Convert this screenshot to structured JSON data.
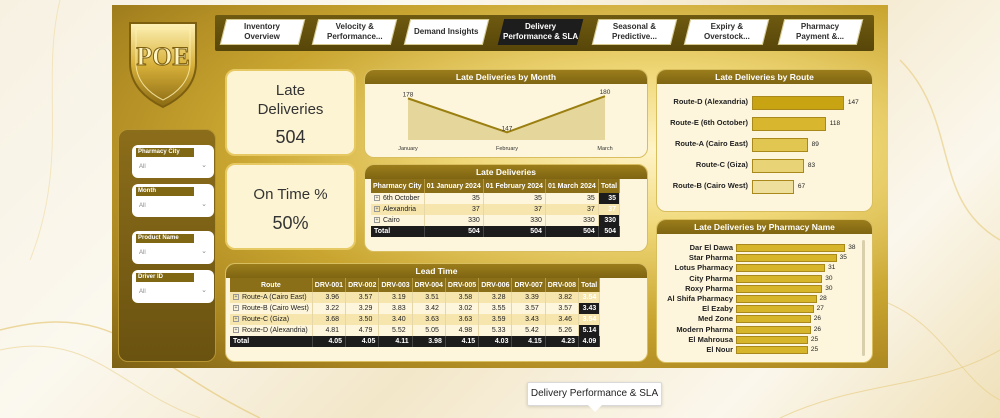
{
  "nav": {
    "items": [
      {
        "label": "Inventory Overview",
        "lines": [
          "Inventory",
          "Overview"
        ],
        "active": false
      },
      {
        "label": "Velocity & Performance...",
        "lines": [
          "Velocity &",
          "Performance..."
        ],
        "active": false
      },
      {
        "label": "Demand Insights",
        "lines": [
          "Demand Insights"
        ],
        "active": false
      },
      {
        "label": "Delivery Performance & SLA",
        "lines": [
          "Delivery",
          "Performance & SLA"
        ],
        "active": true
      },
      {
        "label": "Seasonal & Predictive...",
        "lines": [
          "Seasonal &",
          "Predictive..."
        ],
        "active": false
      },
      {
        "label": "Expiry & Overstock...",
        "lines": [
          "Expiry &",
          "Overstock..."
        ],
        "active": false
      },
      {
        "label": "Pharmacy Payment &...",
        "lines": [
          "Pharmacy",
          "Payment &..."
        ],
        "active": false
      }
    ]
  },
  "logo": {
    "text": "POE"
  },
  "filters": [
    {
      "title": "Pharmacy City",
      "value": "All"
    },
    {
      "title": "Month",
      "value": "All"
    },
    {
      "title": "Product Name",
      "value": "All"
    },
    {
      "title": "Driver ID",
      "value": "All"
    }
  ],
  "kpis": {
    "late": {
      "title_lines": [
        "Late",
        "Deliveries"
      ],
      "value": "504"
    },
    "ontime": {
      "title": "On Time %",
      "value": "50%"
    }
  },
  "late_by_month": {
    "title": "Late Deliveries by Month",
    "chart_data": {
      "type": "area",
      "categories": [
        "January",
        "February",
        "March"
      ],
      "values": [
        178,
        147,
        180
      ],
      "labels": [
        "178",
        "147",
        "180"
      ]
    }
  },
  "late_table": {
    "title": "Late Deliveries",
    "headers": [
      "Pharmacy City",
      "01 January 2024",
      "01 February 2024",
      "01 March 2024",
      "Total"
    ],
    "rows": [
      [
        "6th October",
        "35",
        "35",
        "35",
        "35"
      ],
      [
        "Alexandria",
        "37",
        "37",
        "37",
        "37"
      ],
      [
        "Cairo",
        "330",
        "330",
        "330",
        "330"
      ]
    ],
    "total": [
      "Total",
      "504",
      "504",
      "504",
      "504"
    ]
  },
  "lead_time": {
    "title": "Lead Time",
    "headers": [
      "Route",
      "DRV-001",
      "DRV-002",
      "DRV-003",
      "DRV-004",
      "DRV-005",
      "DRV-006",
      "DRV-007",
      "DRV-008",
      "Total"
    ],
    "rows": [
      [
        "Route-A (Cairo East)",
        "3.96",
        "3.57",
        "3.19",
        "3.51",
        "3.58",
        "3.28",
        "3.39",
        "3.82",
        "3.54"
      ],
      [
        "Route-B (Cairo West)",
        "3.22",
        "3.29",
        "3.83",
        "3.42",
        "3.02",
        "3.55",
        "3.57",
        "3.57",
        "3.43"
      ],
      [
        "Route-C (Giza)",
        "3.68",
        "3.50",
        "3.40",
        "3.63",
        "3.63",
        "3.59",
        "3.43",
        "3.46",
        "3.54"
      ],
      [
        "Route-D (Alexandria)",
        "4.81",
        "4.79",
        "5.52",
        "5.05",
        "4.98",
        "5.33",
        "5.42",
        "5.26",
        "5.14"
      ]
    ],
    "total": [
      "Total",
      "4.05",
      "4.05",
      "4.11",
      "3.98",
      "4.15",
      "4.03",
      "4.15",
      "4.23",
      "4.09"
    ]
  },
  "late_by_route": {
    "title": "Late Deliveries by Route",
    "chart_data": {
      "type": "bar",
      "categories": [
        "Route-D (Alexandria)",
        "Route-E (6th October)",
        "Route-A (Cairo East)",
        "Route-C (Giza)",
        "Route-B (Cairo West)"
      ],
      "values": [
        147,
        118,
        89,
        83,
        67
      ],
      "colors": [
        "#c9a412",
        "#d8b62e",
        "#e1c752",
        "#e8d477",
        "#eedf9c"
      ]
    }
  },
  "late_by_pharmacy": {
    "title": "Late Deliveries by Pharmacy Name",
    "chart_data": {
      "type": "bar",
      "categories": [
        "Dar El Dawa",
        "Star Pharma",
        "Lotus Pharmacy",
        "City Pharma",
        "Roxy Pharma",
        "Al Shifa Pharmacy",
        "El Ezaby",
        "Med Zone",
        "Modern Pharma",
        "El Mahrousa",
        "El Nour"
      ],
      "values": [
        38,
        35,
        31,
        30,
        30,
        28,
        27,
        26,
        26,
        25,
        25
      ]
    }
  },
  "tooltip": {
    "text": "Delivery Performance & SLA"
  },
  "colors": {
    "accent": "#8a6e18",
    "dark": "#1c1c1c",
    "panel": "#fdf6dc"
  }
}
